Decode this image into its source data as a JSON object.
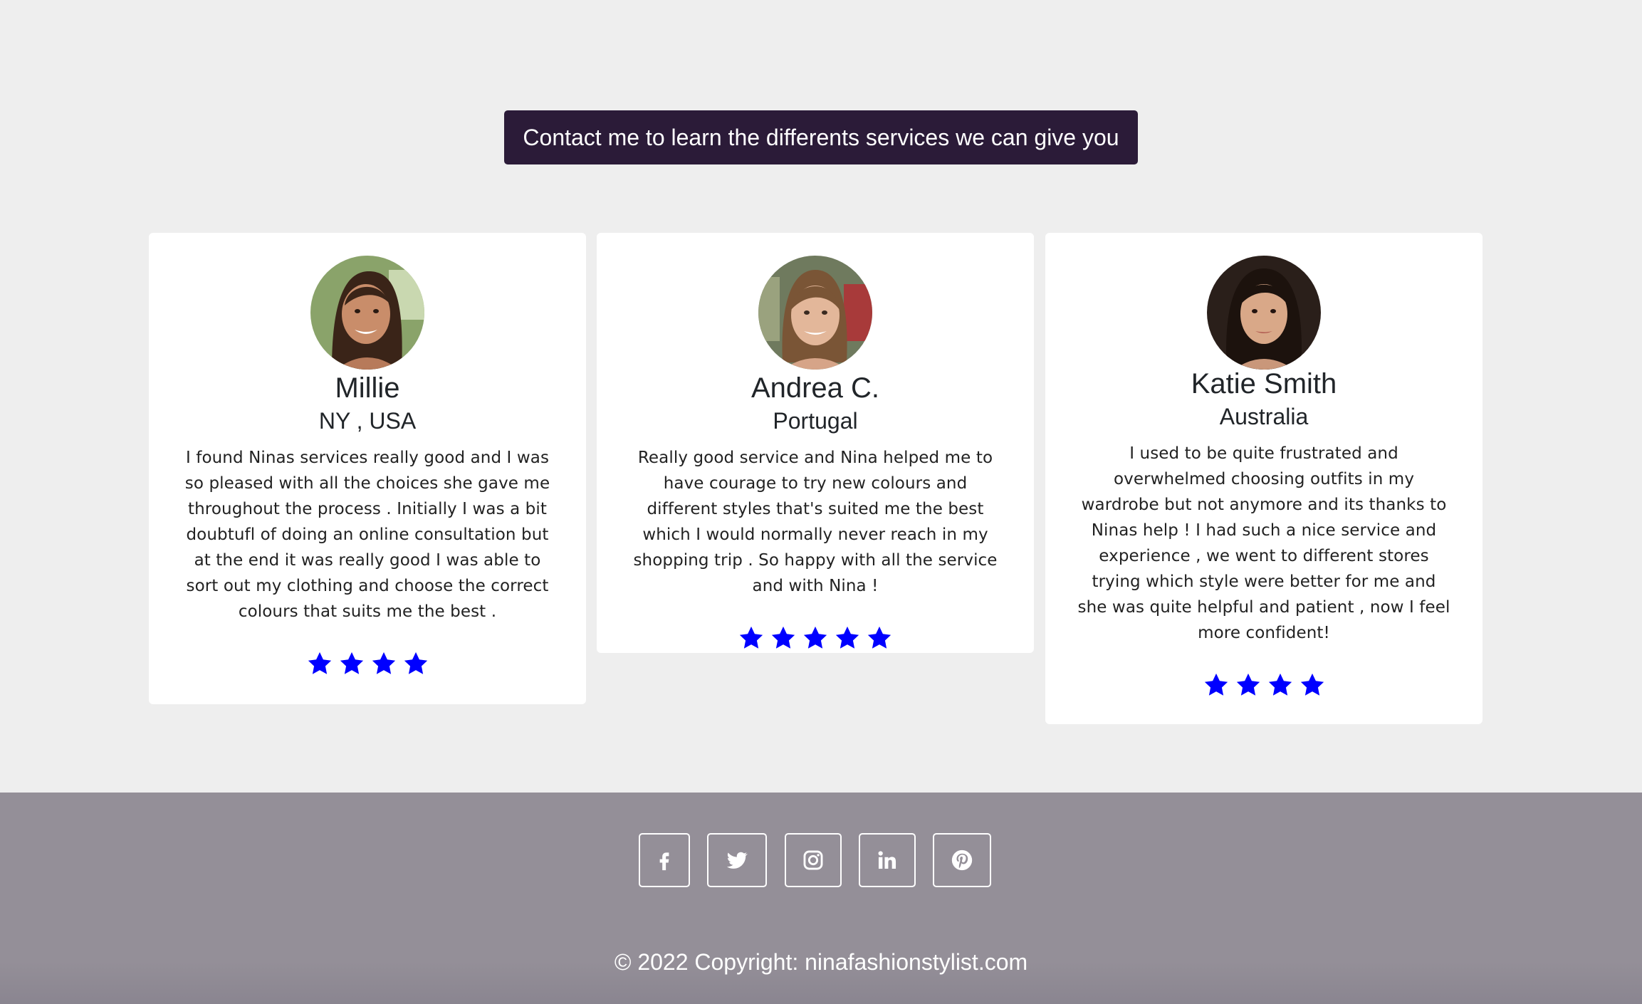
{
  "cta": {
    "label": "Contact me to learn the differents services we can give you"
  },
  "testimonials": [
    {
      "name": "Millie",
      "location": "NY , USA",
      "quote": "I found Ninas services really good and I was so pleased with all the choices she gave me throughout the process . Initially I was a bit doubtufl of doing an online consultation but at the end it was really good I was able to sort out my clothing and choose the correct colours that suits me the best .",
      "rating": 4,
      "avatar": "woman-portrait-1"
    },
    {
      "name": "Andrea C.",
      "location": "Portugal",
      "quote": "Really good service and Nina helped me to have courage to try new colours and different styles that's suited me the best which I would normally never reach in my shopping trip . So happy with all the service and with Nina !",
      "rating": 5,
      "avatar": "woman-portrait-2"
    },
    {
      "name": "Katie Smith",
      "location": "Australia",
      "quote": "I used to be quite frustrated and overwhelmed choosing outfits in my wardrobe but not anymore and its thanks to Ninas help ! I had such a nice service and experience , we went to different stores trying which style were better for me and she was quite helpful and patient , now I feel more confident!",
      "rating": 4,
      "avatar": "woman-portrait-3"
    }
  ],
  "colors": {
    "star": "#0000ff",
    "cta_bg": "#2b1b38",
    "footer_bg": "#948f98",
    "page_bg": "#eeeeee"
  },
  "social": [
    "facebook-icon",
    "twitter-icon",
    "instagram-icon",
    "linkedin-icon",
    "pinterest-icon"
  ],
  "footer": {
    "copyright": "© 2022 Copyright: ninafashionstylist.com"
  }
}
